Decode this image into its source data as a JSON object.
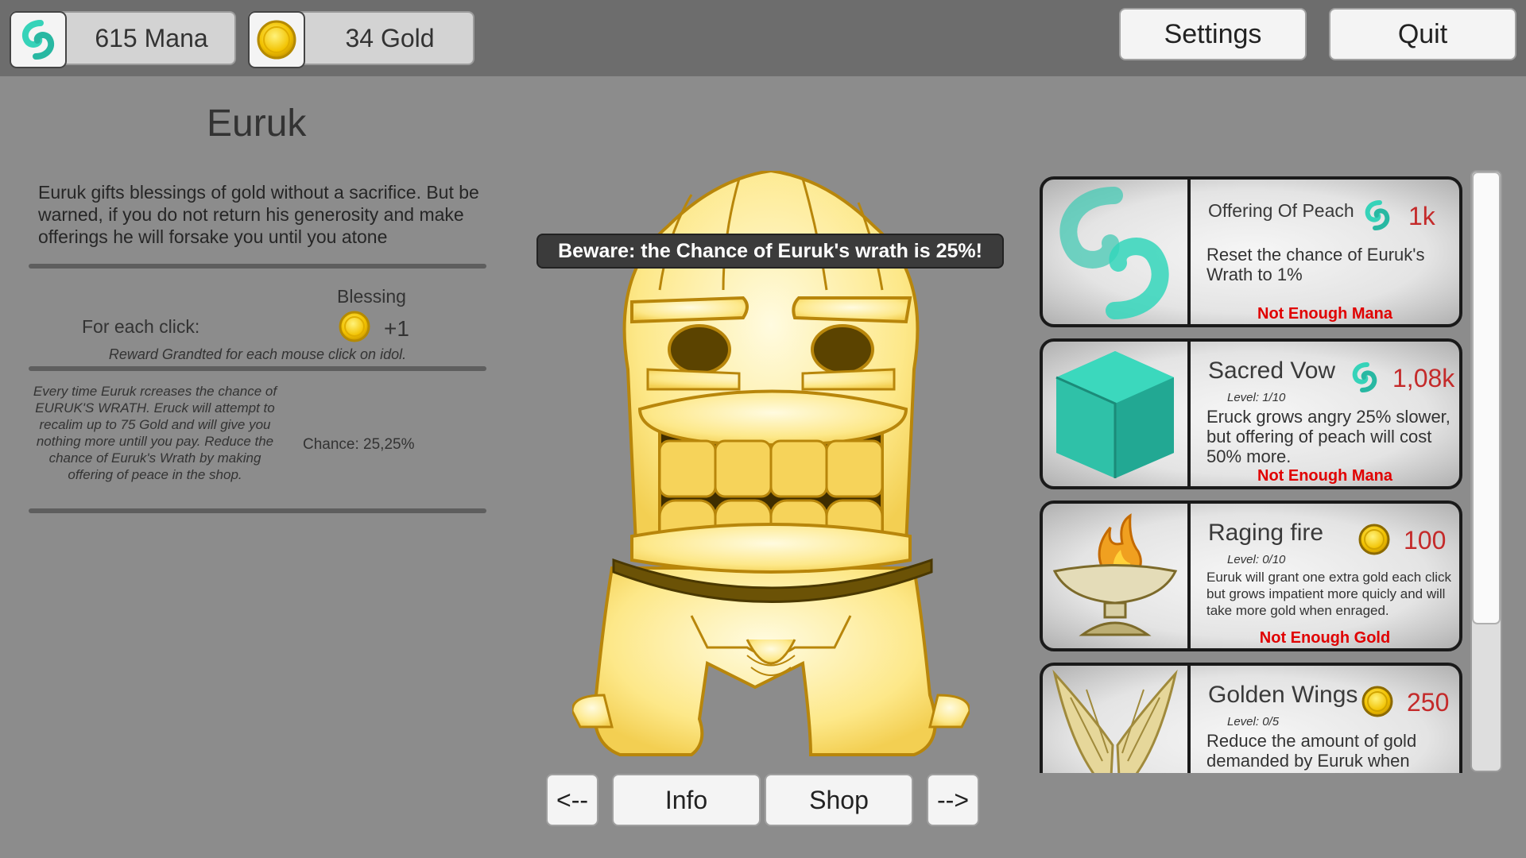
{
  "resources": {
    "mana": "615 Mana",
    "gold": "34 Gold"
  },
  "header": {
    "settings_label": "Settings",
    "quit_label": "Quit"
  },
  "god": {
    "name": "Euruk",
    "description": "Euruk gifts blessings of gold without a sacrifice. But be warned, if you do not return his generosity and make offerings he will forsake you until you atone",
    "blessing_header": "Blessing",
    "click_label": "For each click:",
    "click_value": "+1",
    "reward_note": "Reward Grandted for each mouse click on idol.",
    "wrath_description": "Every time Euruk rcreases the chance of EURUK'S WRATH. Eruck will attempt to recalim up to 75 Gold and will give you nothing more untill you pay. Reduce the chance of Euruk's Wrath by making offering of peace in the shop.",
    "chance": "Chance: 25,25%"
  },
  "warning": "Beware: the Chance of Euruk's wrath is 25%!",
  "nav": {
    "prev": "<--",
    "info": "Info",
    "shop": "Shop",
    "next": "-->"
  },
  "shop": {
    "items": [
      {
        "name": "Offering Of Peach",
        "level": "",
        "price": "1k",
        "currency_icon": "mana-icon",
        "description": "Reset the chance of Euruk's Wrath to 1%",
        "status": "Not Enough Mana",
        "image_icon": "mana-swirl-icon"
      },
      {
        "name": "Sacred Vow",
        "level": "Level: 1/10",
        "price": "1,08k",
        "currency_icon": "mana-icon",
        "description": "Eruck grows angry 25% slower, but offering of peach will cost 50% more.",
        "status": "Not Enough Mana",
        "image_icon": "cube-icon"
      },
      {
        "name": "Raging fire",
        "level": "Level: 0/10",
        "price": "100",
        "currency_icon": "gold-coin-icon",
        "description": "Euruk will grant one extra gold each click but grows impatient more quicly and will take more gold when enraged.",
        "status": "Not Enough Gold",
        "image_icon": "fire-brazier-icon"
      },
      {
        "name": "Golden Wings",
        "level": "Level: 0/5",
        "price": "250",
        "currency_icon": "gold-coin-icon",
        "description": "Reduce the amount of gold demanded by Euruk when",
        "status": "",
        "image_icon": "golden-wings-icon"
      }
    ]
  },
  "colors": {
    "price_red": "#c42a2a",
    "status_red": "#e00000",
    "mana_teal": "#3fd6bd",
    "gold": "#f2c200"
  }
}
